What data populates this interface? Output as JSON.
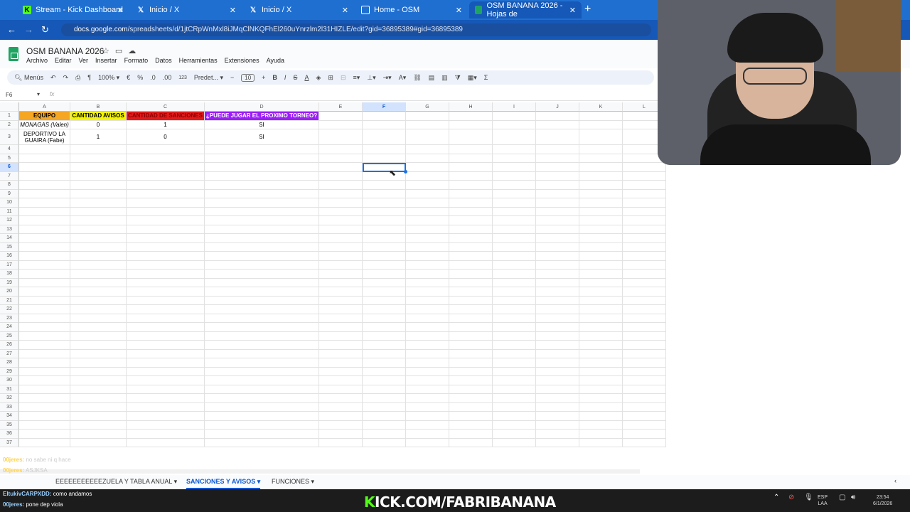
{
  "browser": {
    "tabs": [
      {
        "title": "Stream - Kick Dashboard",
        "icon": "K"
      },
      {
        "title": "Inicio / X",
        "icon": "X"
      },
      {
        "title": "Inicio / X",
        "icon": "X"
      },
      {
        "title": "Home - OSM",
        "icon": "doc"
      },
      {
        "title": "OSM BANANA 2026 - Hojas de",
        "icon": "sheets",
        "active": true
      }
    ],
    "url_host": "docs.google.com",
    "url_path": "/spreadsheets/d/1jtCRpWnMxl8iJMqClNKQFhEl260uYnrzlm2l31HIZLE/edit?gid=36895389#gid=36895389"
  },
  "doc": {
    "title": "OSM BANANA 2026",
    "menus": [
      "Archivo",
      "Editar",
      "Ver",
      "Insertar",
      "Formato",
      "Datos",
      "Herramientas",
      "Extensiones",
      "Ayuda"
    ]
  },
  "toolbar": {
    "search": "Menús",
    "zoom": "100%",
    "currency": "€",
    "percent": "%",
    "dec_less": ".0",
    "dec_more": ".00",
    "numfmt": "123",
    "font": "Predet...",
    "font_size": "10"
  },
  "formula": {
    "cell_ref": "F6",
    "fx": "fx"
  },
  "grid": {
    "columns": [
      "A",
      "B",
      "C",
      "D",
      "E",
      "F",
      "G",
      "H",
      "I",
      "J",
      "K",
      "L"
    ],
    "rows": [
      "1",
      "2",
      "3",
      "4",
      "5",
      "6",
      "7",
      "8",
      "9",
      "10",
      "11",
      "12",
      "13",
      "14",
      "15",
      "16",
      "17",
      "18",
      "19",
      "20",
      "21",
      "22",
      "23",
      "24",
      "25",
      "26",
      "27",
      "28",
      "29",
      "30",
      "31",
      "32",
      "33",
      "34",
      "35",
      "36",
      "37"
    ],
    "headers": [
      "EQUIPO",
      "CANTIDAD AVISOS",
      "CANTIDAD DE SANCIONES",
      "¿PUEDE JUGAR EL PROXIMO TORNEO?"
    ],
    "header_colors": [
      "#f5a623",
      "#f4f400",
      "#e01b1b",
      "#9a1ef5"
    ],
    "data": [
      [
        "MONAGAS (Valen)",
        "0",
        "1",
        "SI"
      ],
      [
        "DEPORTIVO LA GUAIRA (Fabe)",
        "1",
        "0",
        "SI"
      ]
    ]
  },
  "sheet_tabs": [
    {
      "label": "EEEEEEEEEEEZUELA Y TABLA ANUAL"
    },
    {
      "label": "SANCIONES Y AVISOS",
      "active": true
    },
    {
      "label": "FUNCIONES"
    }
  ],
  "stream_overlay": {
    "chat": [
      {
        "user": "00jeres:",
        "msg": "no sabe ni q hace"
      },
      {
        "user": "00jeres:",
        "msg": "ASJKSA"
      },
      {
        "user": "EltukivCARPXDD:",
        "msg": "como andamos"
      },
      {
        "user": "00jeres:",
        "msg": "pone dep viola"
      }
    ],
    "kick_url": "KICK.COM/FABRIBANANA"
  },
  "system_tray": {
    "lang": "ESP",
    "layout": "LAA",
    "time": "23:54",
    "date": "6/1/2026"
  }
}
